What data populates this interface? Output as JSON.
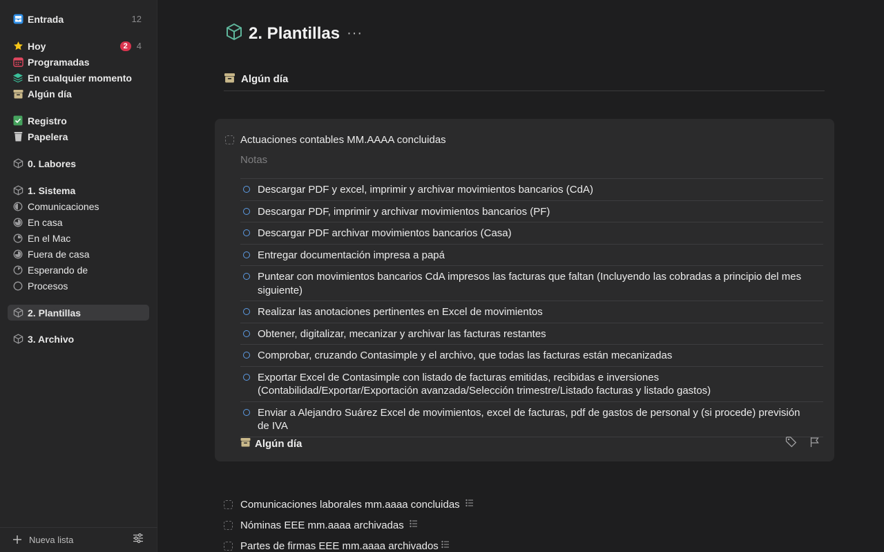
{
  "sidebar": {
    "inbox": {
      "label": "Entrada",
      "count": "12"
    },
    "today": {
      "label": "Hoy",
      "badge": "2",
      "count": "4"
    },
    "upcoming": {
      "label": "Programadas"
    },
    "anytime": {
      "label": "En cualquier momento"
    },
    "someday": {
      "label": "Algún día"
    },
    "logbook": {
      "label": "Registro"
    },
    "trash": {
      "label": "Papelera"
    },
    "areas": [
      {
        "label": "0. Labores"
      },
      {
        "label": "1. Sistema"
      },
      {
        "label": "2. Plantillas"
      },
      {
        "label": "3. Archivo"
      }
    ],
    "projects": [
      {
        "label": "Comunicaciones"
      },
      {
        "label": "En casa"
      },
      {
        "label": "En el Mac"
      },
      {
        "label": "Fuera de casa"
      },
      {
        "label": "Esperando de"
      },
      {
        "label": "Procesos"
      }
    ],
    "footer": {
      "new_list": "Nueva lista"
    }
  },
  "main": {
    "title": "2. Plantillas",
    "more": "···",
    "section": "Algún día",
    "card": {
      "title": "Actuaciones contables MM.AAAA concluidas",
      "notes_placeholder": "Notas",
      "checklist": [
        "Descargar PDF y excel, imprimir y archivar movimientos bancarios (CdA)",
        "Descargar PDF, imprimir y archivar movimientos bancarios (PF)",
        "Descargar PDF archivar movimientos bancarios (Casa)",
        "Entregar documentación impresa a papá",
        "Puntear con movimientos bancarios CdA impresos las facturas que faltan (Incluyendo las cobradas a principio del mes siguiente)",
        "Realizar las anotaciones pertinentes en Excel de movimientos",
        "Obtener, digitalizar, mecanizar y archivar las facturas restantes",
        "Comprobar, cruzando Contasimple y el archivo, que todas las facturas están mecanizadas",
        "Exportar Excel de Contasimple con listado de facturas emitidas, recibidas e inversiones (Contabilidad/Exportar/Exportación avanzada/Selección trimestre/Listado facturas y listado gastos)",
        "Enviar a Alejandro Suárez Excel de movimientos, excel de facturas, pdf de gastos de personal y (si procede) previsión de IVA"
      ],
      "when": "Algún día"
    },
    "tasks": [
      "Comunicaciones laborales mm.aaaa concluidas",
      "Nóminas EEE mm.aaaa archivadas",
      "Partes de firmas EEE mm.aaaa archivados"
    ]
  },
  "colors": {
    "accent_blue": "#5d9de6",
    "badge_red": "#d8344e",
    "someday_tan": "#c9b88a"
  }
}
